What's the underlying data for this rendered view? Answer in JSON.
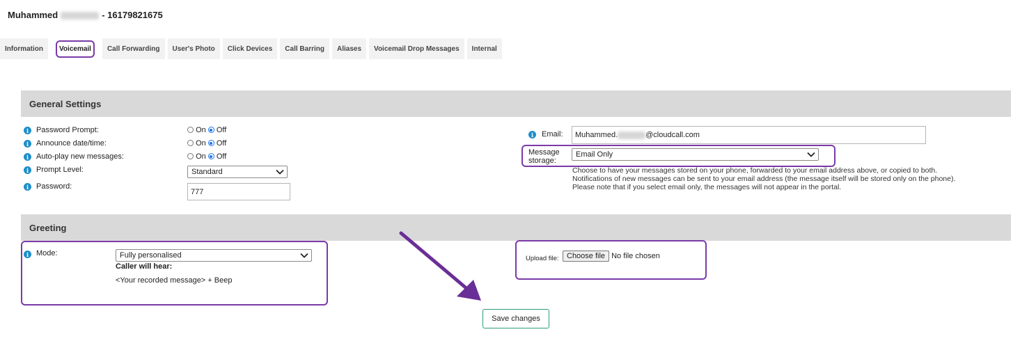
{
  "header": {
    "first_name": "Muhammed",
    "separator_number": "- 16179821675"
  },
  "tabs": [
    {
      "label": "Information",
      "active": false
    },
    {
      "label": "Voicemail",
      "active": true
    },
    {
      "label": "Call Forwarding",
      "active": false
    },
    {
      "label": "User's Photo",
      "active": false
    },
    {
      "label": "Click Devices",
      "active": false
    },
    {
      "label": "Call Barring",
      "active": false
    },
    {
      "label": "Aliases",
      "active": false
    },
    {
      "label": "Voicemail Drop Messages",
      "active": false
    },
    {
      "label": "Internal",
      "active": false
    }
  ],
  "general": {
    "title": "General Settings",
    "password_prompt": {
      "label": "Password Prompt:",
      "on": "On",
      "off": "Off",
      "selected": "Off"
    },
    "announce_datetime": {
      "label": "Announce date/time:",
      "on": "On",
      "off": "Off",
      "selected": "Off"
    },
    "autoplay": {
      "label": "Auto-play new messages:",
      "on": "On",
      "off": "Off",
      "selected": "Off"
    },
    "prompt_level": {
      "label": "Prompt Level:",
      "value": "Standard"
    },
    "password": {
      "label": "Password:",
      "value": "777"
    },
    "email": {
      "label": "Email:",
      "value_prefix": "Muhammed.",
      "value_suffix": "@cloudcall.com"
    },
    "message_storage": {
      "label_line1": "Message",
      "label_line2": "storage:",
      "value": "Email Only"
    },
    "storage_note": [
      "Choose to have your messages stored on your phone, forwarded to your email address above, or copied to both.",
      "Notifications of new messages can be sent to your email address (the message itself will be stored only on the phone).",
      "Please note that if you select email only, the messages will not appear in the portal."
    ]
  },
  "greeting": {
    "title": "Greeting",
    "mode": {
      "label": "Mode:",
      "value": "Fully personalised"
    },
    "caller_hears_label": "Caller will hear:",
    "caller_hears_value": "<Your recorded message> + Beep",
    "upload": {
      "label": "Upload file:",
      "button": "Choose file",
      "status": "No file chosen"
    }
  },
  "actions": {
    "save_label": "Save changes"
  },
  "colors": {
    "accent": "#7a3aa7",
    "info": "#1f8ec9",
    "section_bg": "#d9d9d9",
    "save_border": "#2e9b7a"
  },
  "icons": [
    "info-icon",
    "chevron-down-icon",
    "arrow-annotation"
  ]
}
